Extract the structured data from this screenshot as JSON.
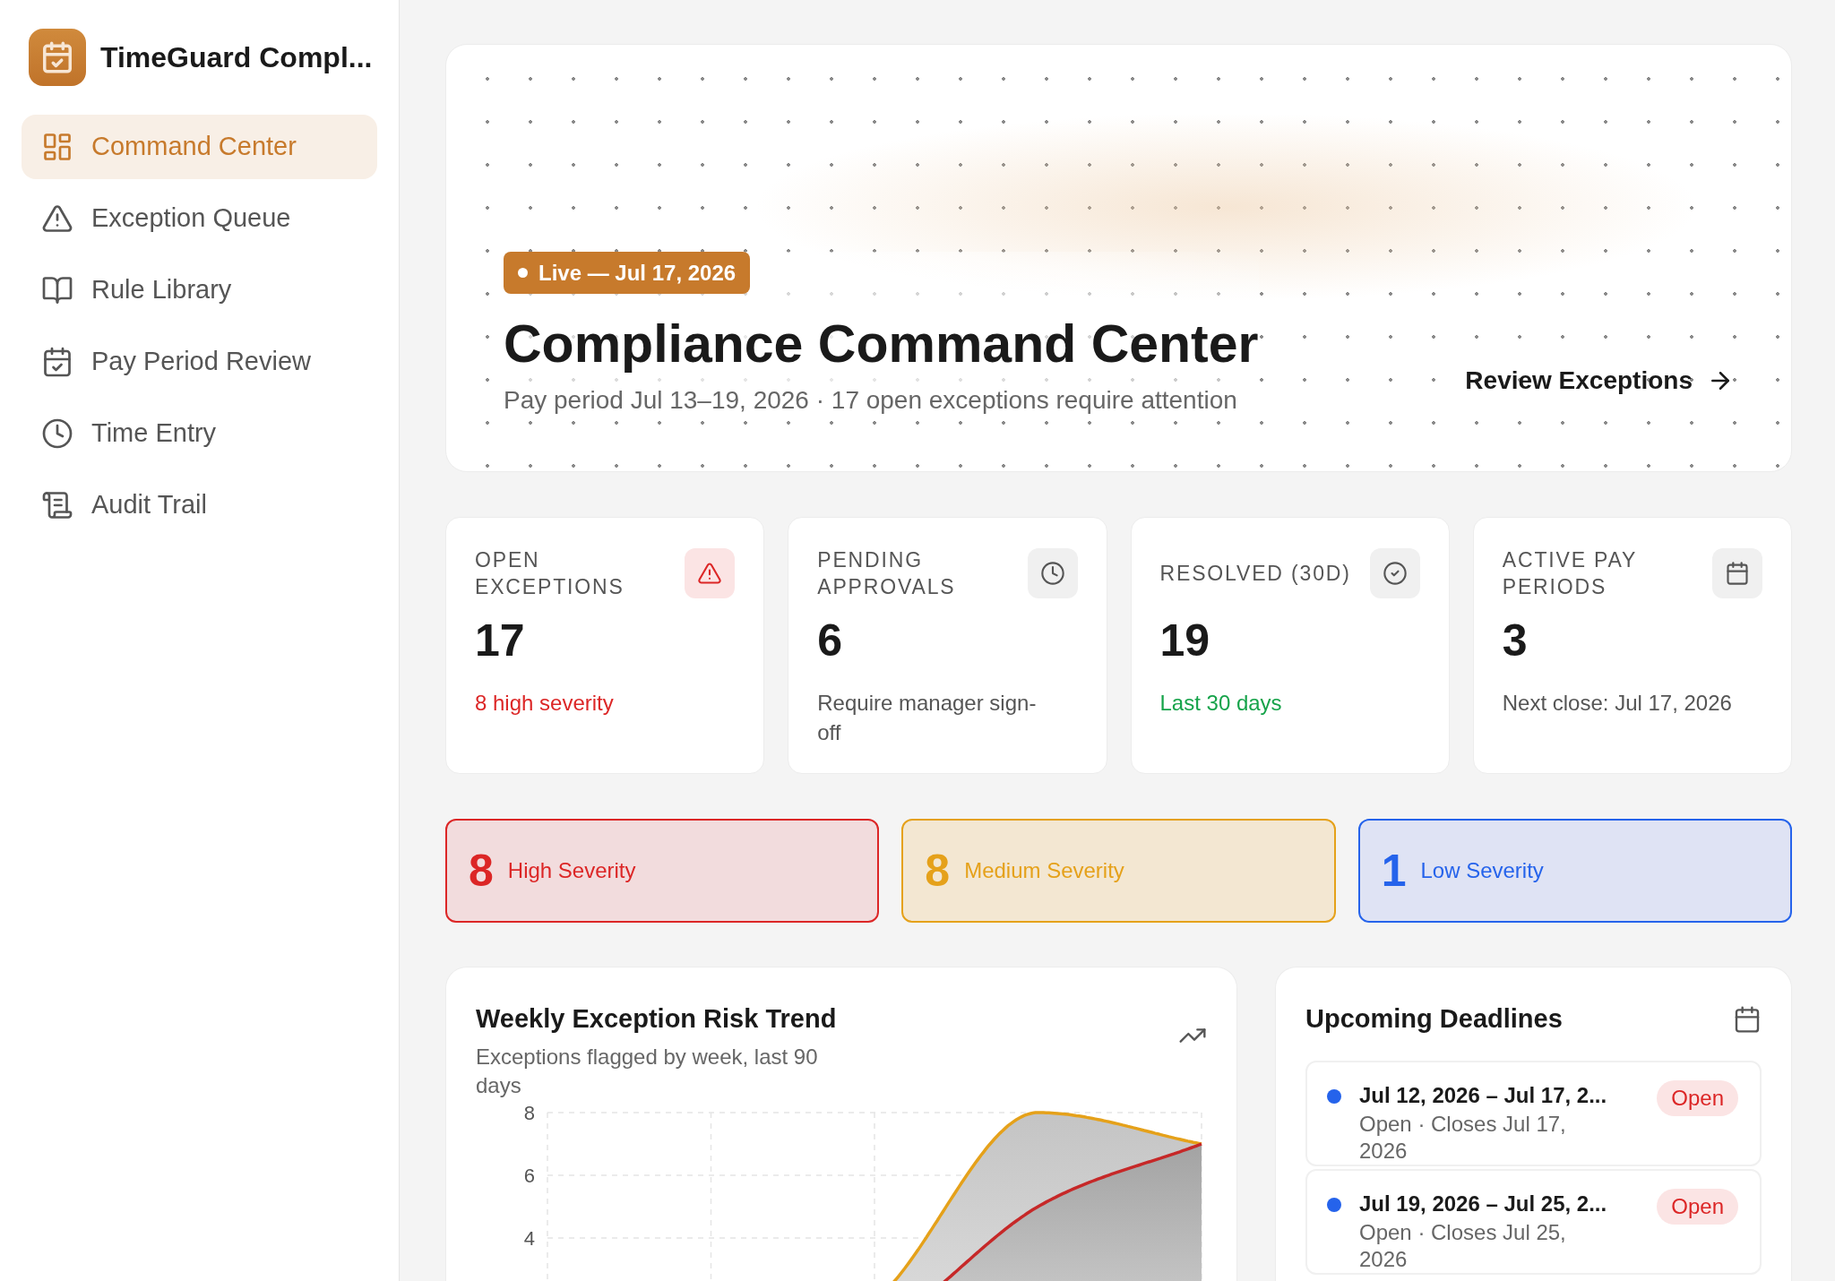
{
  "app": {
    "title": "TimeGuard Compl..."
  },
  "sidebar": {
    "items": [
      {
        "label": "Command Center",
        "selected": true
      },
      {
        "label": "Exception Queue",
        "selected": false
      },
      {
        "label": "Rule Library",
        "selected": false
      },
      {
        "label": "Pay Period Review",
        "selected": false
      },
      {
        "label": "Time Entry",
        "selected": false
      },
      {
        "label": "Audit Trail",
        "selected": false
      }
    ]
  },
  "hero": {
    "badge": "Live — Jul 17, 2026",
    "title": "Compliance Command Center",
    "subtitle": "Pay period Jul 13–19, 2026 · 17 open exceptions require attention",
    "action": "Review Exceptions"
  },
  "stats": [
    {
      "label": "OPEN EXCEPTIONS",
      "value": "17",
      "note": "8 high severity",
      "color": "#dc2626",
      "highlighted": true
    },
    {
      "label": "PENDING APPROVALS",
      "value": "6",
      "note": "Require manager sign-off",
      "color": "#555555",
      "highlighted": false
    },
    {
      "label": "RESOLVED (30D)",
      "value": "19",
      "note": "Last 30 days",
      "color": "#16a34a",
      "highlighted": false
    },
    {
      "label": "ACTIVE PAY PERIODS",
      "value": "3",
      "note": "Next close: Jul 17, 2026",
      "color": "#555555",
      "highlighted": false
    }
  ],
  "severity": [
    {
      "count": "8",
      "label": "High Severity",
      "kind": "high"
    },
    {
      "count": "8",
      "label": "Medium Severity",
      "kind": "medium"
    },
    {
      "count": "1",
      "label": "Low Severity",
      "kind": "low"
    }
  ],
  "trend": {
    "title": "Weekly Exception Risk Trend",
    "subtitle": "Exceptions flagged by week, last 90 days",
    "y_axis_labels": [
      "8",
      "6",
      "4"
    ]
  },
  "deadlines": {
    "title": "Upcoming Deadlines",
    "items": [
      {
        "period": "Jul 12, 2026 – Jul 17, 2...",
        "detail": "Open · Closes Jul 17, 2026",
        "status": "Open",
        "color": "#2563eb"
      },
      {
        "period": "Jul 19, 2026 – Jul 25, 2...",
        "detail": "Open · Closes Jul 25, 2026",
        "status": "Open",
        "color": "#2563eb"
      }
    ]
  }
}
